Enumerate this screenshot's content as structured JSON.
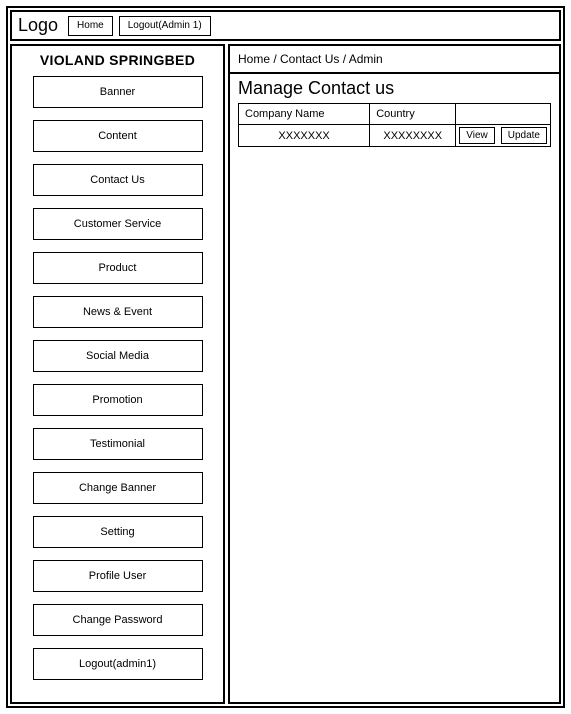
{
  "header": {
    "logo_text": "Logo",
    "home_label": "Home",
    "logout_label": "Logout(Admin 1)"
  },
  "sidebar": {
    "title": "VIOLAND SPRINGBED",
    "items": [
      {
        "label": "Banner"
      },
      {
        "label": "Content"
      },
      {
        "label": "Contact Us"
      },
      {
        "label": "Customer Service"
      },
      {
        "label": "Product"
      },
      {
        "label": "News & Event"
      },
      {
        "label": "Social Media"
      },
      {
        "label": "Promotion"
      },
      {
        "label": "Testimonial"
      },
      {
        "label": "Change Banner"
      },
      {
        "label": "Setting"
      },
      {
        "label": "Profile User"
      },
      {
        "label": "Change Password"
      },
      {
        "label": "Logout(admin1)"
      }
    ]
  },
  "main": {
    "breadcrumb": "Home / Contact Us / Admin",
    "title": "Manage Contact us",
    "table": {
      "headers": [
        "Company Name",
        "Country",
        ""
      ],
      "rows": [
        {
          "company": "XXXXXXX",
          "country": "XXXXXXXX",
          "view_label": "View",
          "update_label": "Update"
        }
      ]
    }
  }
}
